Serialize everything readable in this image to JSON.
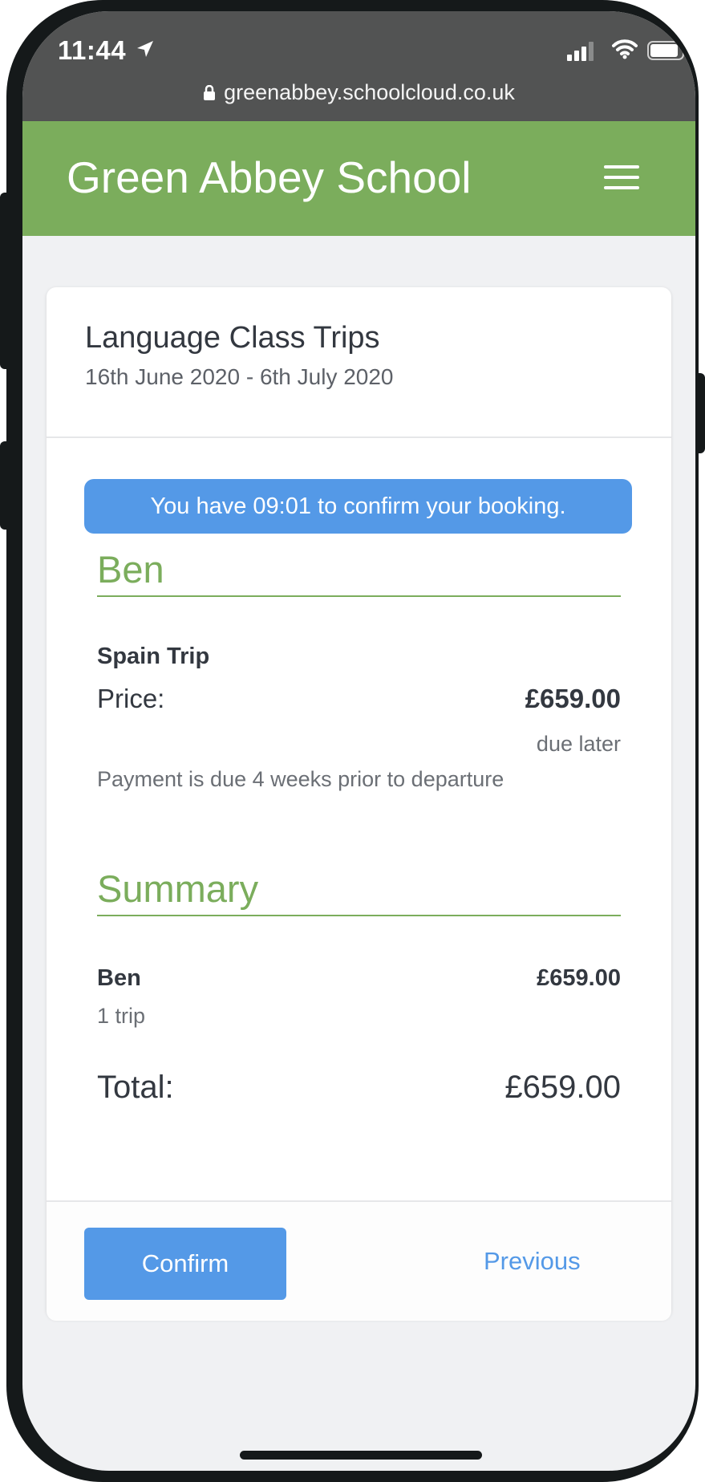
{
  "status_bar": {
    "time": "11:44",
    "url": "greenabbey.schoolcloud.co.uk",
    "icons": [
      "location-arrow-icon",
      "cellular-signal-icon",
      "wifi-icon",
      "battery-icon",
      "lock-icon"
    ]
  },
  "header": {
    "school_name": "Green Abbey School",
    "menu_icon": "hamburger-menu-icon",
    "color": "#7bad5c"
  },
  "card": {
    "title": "Language Class Trips",
    "dates": "16th June 2020 - 6th July 2020",
    "timer_message": "You have 09:01 to confirm your booking.",
    "student": {
      "name": "Ben",
      "trip_name": "Spain Trip",
      "price_label": "Price:",
      "price_value": "£659.00",
      "due_note": "due later",
      "payment_note": "Payment is due 4 weeks prior to departure"
    },
    "summary": {
      "heading": "Summary",
      "student_name": "Ben",
      "student_amount": "£659.00",
      "trip_count": "1 trip",
      "total_label": "Total:",
      "total_value": "£659.00"
    },
    "actions": {
      "confirm_label": "Confirm",
      "previous_label": "Previous"
    }
  },
  "colors": {
    "accent_blue": "#5499e7",
    "brand_green": "#7bad5c",
    "status_bar": "#525353"
  }
}
